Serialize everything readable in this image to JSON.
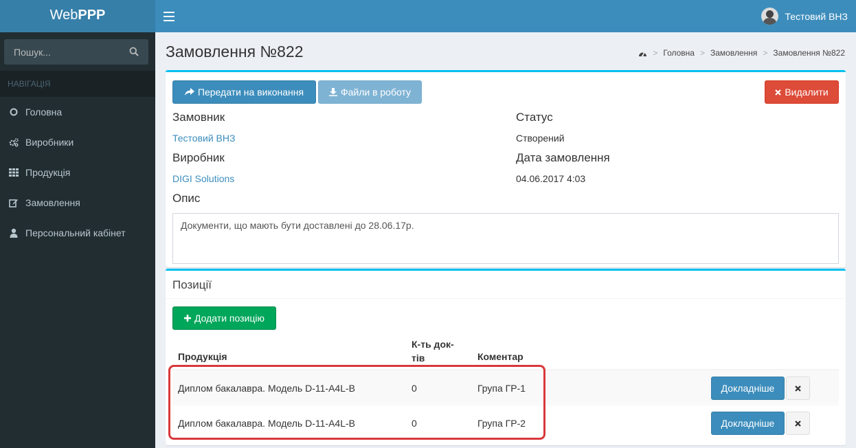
{
  "header": {
    "logo_regular": "Web",
    "logo_bold": "PPP",
    "user_name": "Тестовий ВНЗ"
  },
  "sidebar": {
    "search_placeholder": "Пошук...",
    "nav_header": "НАВІГАЦІЯ",
    "items": [
      {
        "label": "Головна",
        "icon": "circle-icon"
      },
      {
        "label": "Виробники",
        "icon": "gears-icon"
      },
      {
        "label": "Продукція",
        "icon": "grid-icon"
      },
      {
        "label": "Замовлення",
        "icon": "edit-icon"
      },
      {
        "label": "Персональний кабінет",
        "icon": "user-icon"
      }
    ]
  },
  "page": {
    "title": "Замовлення №822",
    "breadcrumb": [
      "Головна",
      "Замовлення",
      "Замовлення №822"
    ]
  },
  "order": {
    "btn_submit": "Передати на виконання",
    "btn_files": "Файли в роботу",
    "btn_delete": "Видалити",
    "customer_label": "Замовник",
    "customer_value": "Тестовий ВНЗ",
    "status_label": "Статус",
    "status_value": "Створений",
    "producer_label": "Виробник",
    "producer_value": "DIGI Solutions",
    "date_label": "Дата замовлення",
    "date_value": "04.06.2017 4:03",
    "desc_label": "Опис",
    "desc_value": "Документи, що мають бути доставлені до 28.06.17р."
  },
  "positions": {
    "title": "Позиції",
    "btn_add": "Додати позицію",
    "columns": {
      "product": "Продукція",
      "count_line1": "К-ть док-",
      "count_line2": "тів",
      "comment": "Коментар"
    },
    "rows": [
      {
        "product": "Диплом бакалавра. Модель D-11-A4L-B",
        "count": "0",
        "comment": "Група ГР-1",
        "details": "Докладніше"
      },
      {
        "product": "Диплом бакалавра. Модель D-11-A4L-B",
        "count": "0",
        "comment": "Група ГР-2",
        "details": "Докладніше"
      }
    ]
  }
}
